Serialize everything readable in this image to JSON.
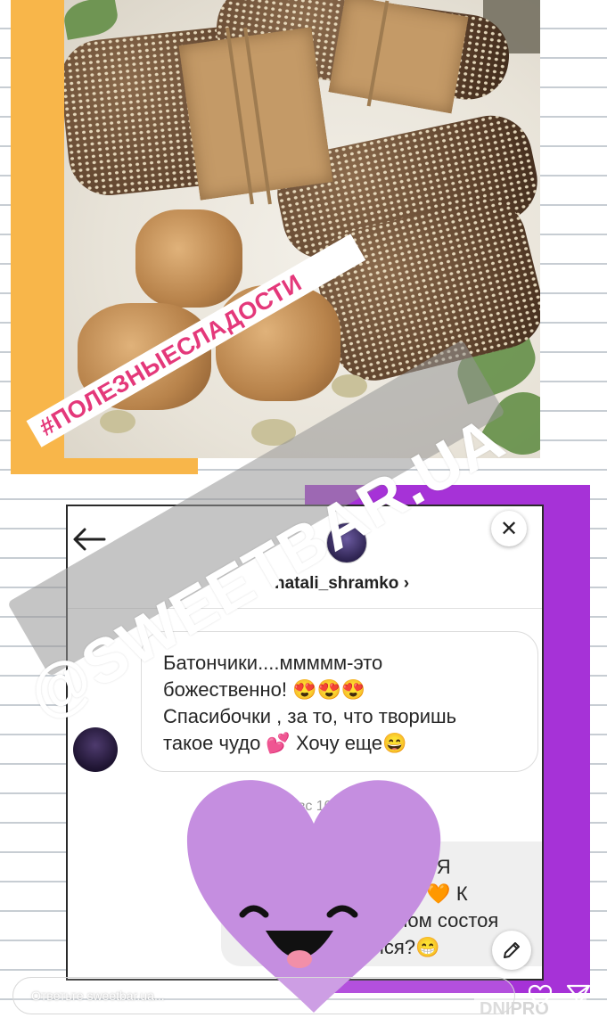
{
  "post": {
    "hashtag": "#ПОЛЕЗНЫЕСЛАДОСТИ",
    "watermark": "@SWEETBAR.UA",
    "photo_subject": "food-photo-sesame-bars-walnuts"
  },
  "dm_screenshot": {
    "username": "natali_shramko",
    "username_chevron": "›",
    "message_lines": [
      "Батончики....ммммм-это",
      "божественно! 😍😍😍",
      "Спасибочки  , за то, что  творишь",
      "такое чудо 💕  Хочу еще😄"
    ],
    "timestamp": "вс 10:21 П",
    "reply_fragments": {
      "line1_left": "",
      "line1_right": "шое 😍 Я",
      "line2": "вкусу 🧡  К",
      "line3": "денном состоя",
      "line4": "лся?😁"
    },
    "close_label": "✕"
  },
  "story_footer": {
    "reply_placeholder": "Ответьте sweetbar.ua...",
    "corner_logo": "DNIPRO"
  },
  "colors": {
    "orange_accent": "#f8b64a",
    "purple_accent": "#a632d7",
    "hashtag_pink": "#e4387a",
    "heart_sticker": "#c58ee0"
  },
  "icons": [
    "back-arrow-icon",
    "close-icon",
    "pencil-icon",
    "heart-icon",
    "send-icon",
    "smiling-heart-sticker"
  ]
}
